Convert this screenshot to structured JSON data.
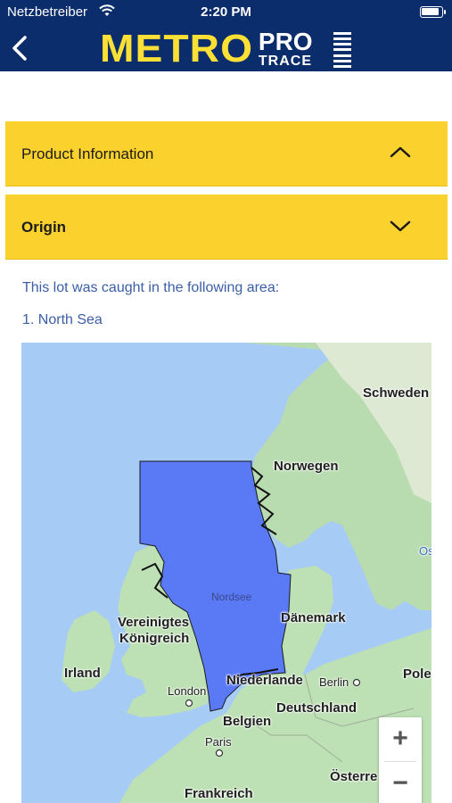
{
  "status_bar": {
    "carrier": "Netzbetreiber",
    "time": "2:20 PM"
  },
  "nav": {
    "logo_main": "METRO",
    "logo_pro": "PRO",
    "logo_trace": "TRACE"
  },
  "sections": [
    {
      "title": "Product Information",
      "expanded": false
    },
    {
      "title": "Origin",
      "expanded": true
    }
  ],
  "origin": {
    "intro": "This lot was caught in the following area:",
    "areas": [
      "1.  North Sea"
    ]
  },
  "map": {
    "sea_label": "Nordsee",
    "labels": {
      "schweden": "Schweden",
      "norwegen": "Norwegen",
      "os": "Os",
      "daenemark": "Dänemark",
      "uk_line1": "Vereinigtes",
      "uk_line2": "Königreich",
      "irland": "Irland",
      "london": "London",
      "niederlande": "Niederlande",
      "berlin": "Berlin",
      "pole": "Pole",
      "deutschland": "Deutschland",
      "belgien": "Belgien",
      "paris": "Paris",
      "oesterreich": "Österre",
      "frankreich": "Frankreich"
    },
    "zoom_in": "+",
    "zoom_out": "−"
  },
  "colors": {
    "header": "#0c2d6b",
    "accent": "#fad12d",
    "link_text": "#3b5ea8",
    "highlight_area": "#5a79f5"
  }
}
